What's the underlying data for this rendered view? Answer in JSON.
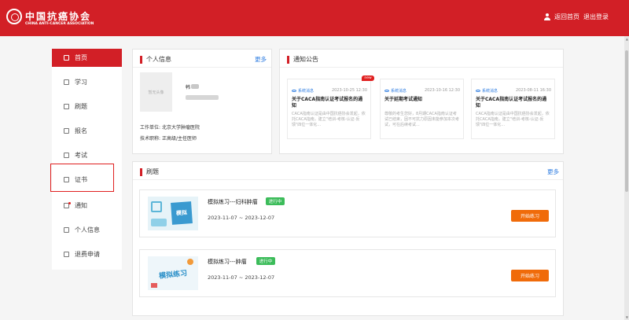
{
  "header": {
    "logo_cn": "中国抗癌协会",
    "logo_en": "CHINA ANTI-CANCER ASSOCIATION",
    "home_link": "返回首页",
    "logout_link": "退出登录",
    "user_icon": "user-icon"
  },
  "sidebar": {
    "items": [
      {
        "label": "首页",
        "icon": "home-icon"
      },
      {
        "label": "学习",
        "icon": "book-icon"
      },
      {
        "label": "刷题",
        "icon": "edit-icon"
      },
      {
        "label": "报名",
        "icon": "document-icon"
      },
      {
        "label": "考试",
        "icon": "exam-icon"
      },
      {
        "label": "证书",
        "icon": "certificate-icon"
      },
      {
        "label": "通知",
        "icon": "mail-icon"
      },
      {
        "label": "个人信息",
        "icon": "person-icon"
      },
      {
        "label": "退费申请",
        "icon": "refund-icon"
      }
    ]
  },
  "profile": {
    "title": "个人信息",
    "more": "更多",
    "photo_placeholder": "暂无头像",
    "name_visible": "韩",
    "org_label": "工作单位:",
    "org_value": "北京大学肿瘤医院",
    "title_label": "技术职称:",
    "title_value": "正高级/主任医师"
  },
  "notices": {
    "title": "通知公告",
    "items": [
      {
        "tag": "系统消息",
        "date": "2023-10-25 12:30",
        "new": "new",
        "headline": "关于CACA指南认证考试报名的通知",
        "body": "CACA指南认证是由中国抗癌协会发起，依托CACA指南，建立\"培训-考核-认证-反馈\"四位一体化..."
      },
      {
        "tag": "系统消息",
        "date": "2023-10-16 12:30",
        "headline": "关于延期考试通知",
        "body": "尊敬的考生您好，8月期CACA指南认证考试已结束，因不可抗力原因未能参加本次考试，可在后续考试..."
      },
      {
        "tag": "系统消息",
        "date": "2023-08-11 16:30",
        "headline": "关于CACA指南认证考试报名的通知",
        "body": "CACA指南认证是由中国抗癌协会发起，依托CACA指南，建立\"培训-考核-认证-反馈\"四位一体化..."
      }
    ]
  },
  "practice": {
    "title": "刷题",
    "more": "更多",
    "items": [
      {
        "title": "模拟练习---妇科肿瘤",
        "status": "进行中",
        "dates": "2023-11-07 ~ 2023-12-07",
        "button": "开始练习",
        "thumb_text": "模拟"
      },
      {
        "title": "模拟练习---肿瘤",
        "status": "进行中",
        "dates": "2023-11-07 ~ 2023-12-07",
        "button": "开始练习",
        "thumb_text": "模拟练习"
      }
    ]
  },
  "colors": {
    "brand_red": "#d21f26",
    "accent_blue": "#2f7de1",
    "status_green": "#3cbc5a",
    "button_orange": "#f06b0a"
  }
}
